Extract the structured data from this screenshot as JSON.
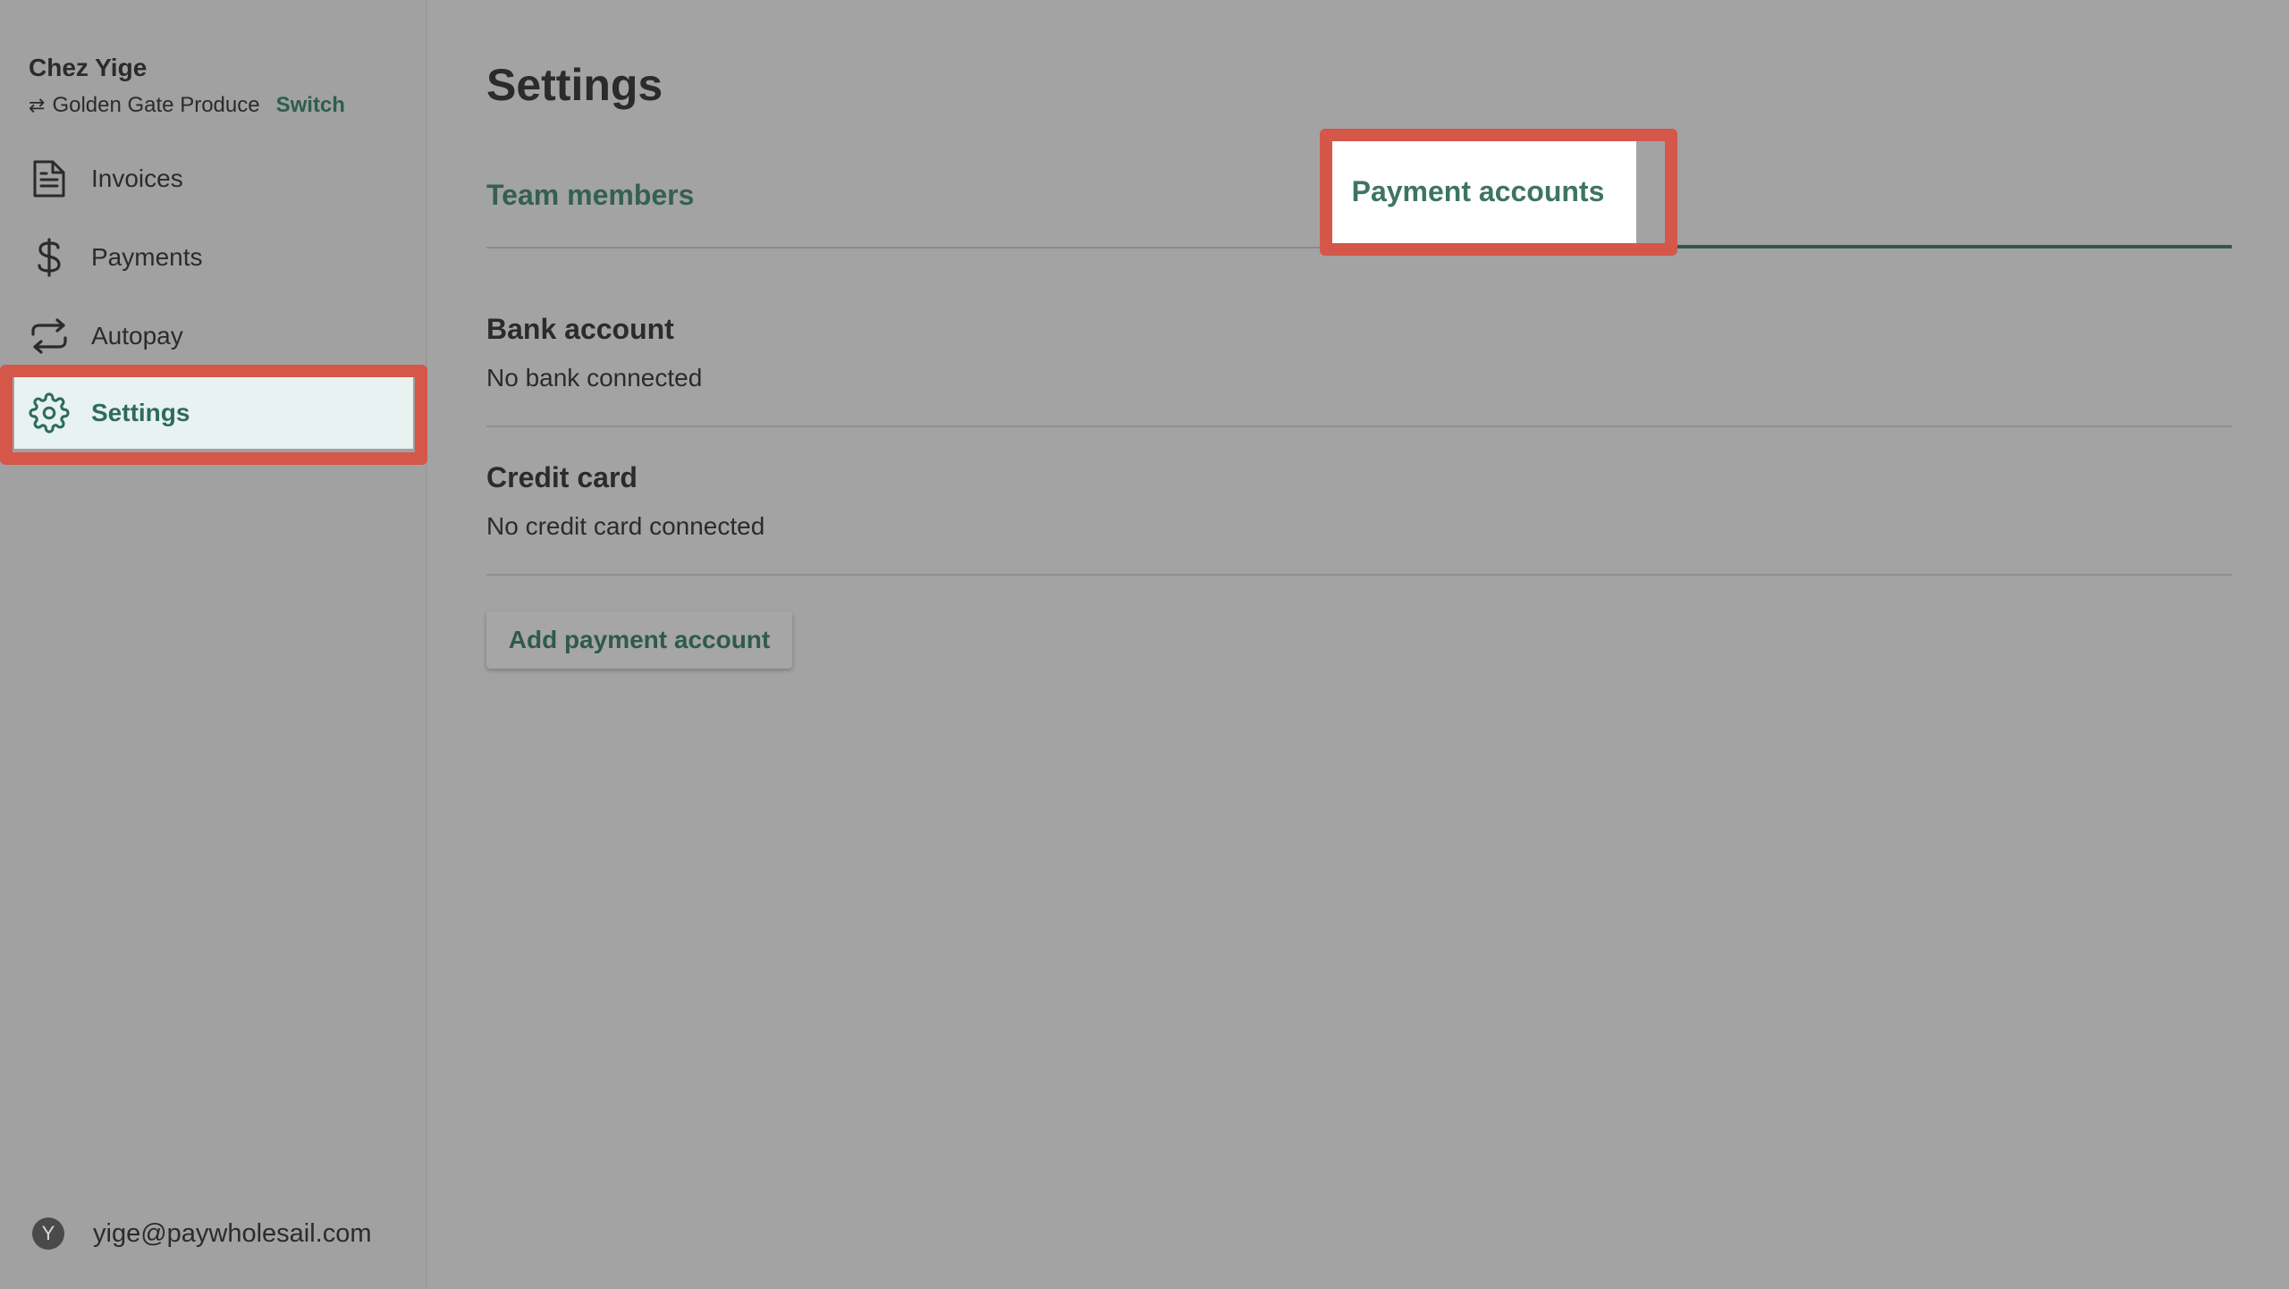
{
  "sidebar": {
    "org_name": "Chez Yige",
    "vendor_name": "Golden Gate Produce",
    "swap_glyph": "⇄",
    "switch_label": "Switch",
    "items": [
      {
        "label": "Invoices",
        "icon": "document-icon"
      },
      {
        "label": "Payments",
        "icon": "dollar-icon"
      },
      {
        "label": "Autopay",
        "icon": "repeat-icon"
      },
      {
        "label": "Settings",
        "icon": "gear-icon",
        "active": true
      }
    ],
    "user": {
      "avatar_initial": "Y",
      "email": "yige@paywholesail.com"
    }
  },
  "main": {
    "title": "Settings",
    "tabs": [
      {
        "label": "Team members"
      },
      {
        "label": "Payment accounts",
        "active": true
      }
    ],
    "bank": {
      "title": "Bank account",
      "status": "No bank connected"
    },
    "card": {
      "title": "Credit card",
      "status": "No credit card connected"
    },
    "add_button_label": "Add payment account"
  },
  "colors": {
    "accent": "#2e6b5a",
    "highlight": "#d4574a",
    "active_nav_bg": "#e7f2f1",
    "overlay_bg": "#a3a3a3"
  }
}
